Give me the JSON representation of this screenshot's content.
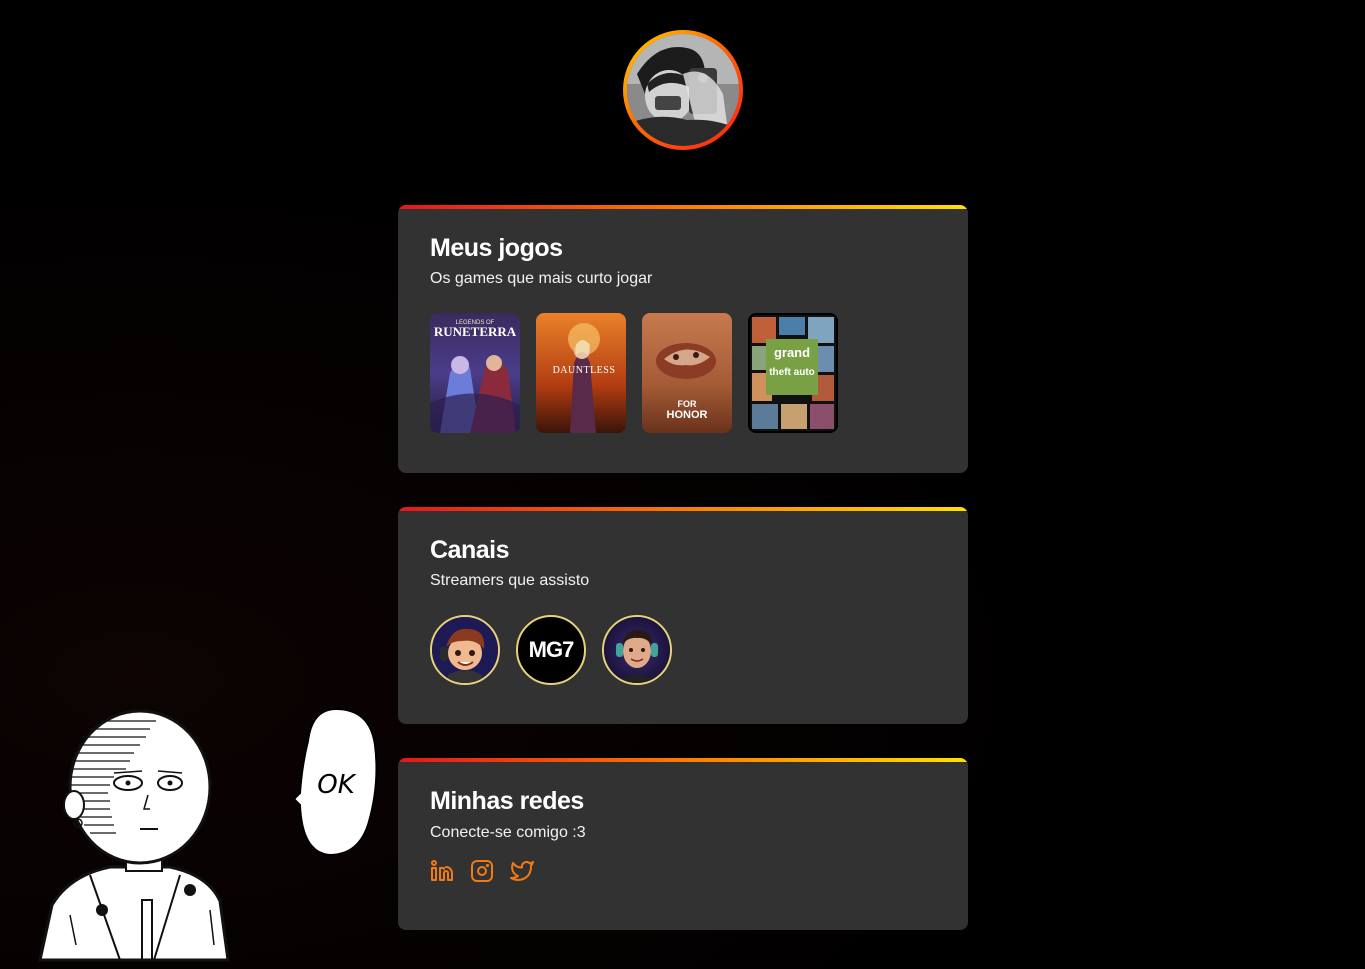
{
  "profile": {
    "avatar_icon": "profile-photo"
  },
  "games_card": {
    "title": "Meus jogos",
    "subtitle": "Os games que mais curto jogar",
    "games": [
      {
        "name": "Legends of Runeterra",
        "cover_text_1": "LEGENDS OF",
        "cover_text_2": "RUNETERRA"
      },
      {
        "name": "Dauntless",
        "cover_text_1": "DAUNTLESS",
        "cover_text_2": ""
      },
      {
        "name": "For Honor",
        "cover_text_1": "FOR",
        "cover_text_2": "HONOR"
      },
      {
        "name": "Grand Theft Auto V",
        "cover_text_1": "grand",
        "cover_text_2": "theft auto"
      }
    ]
  },
  "channels_card": {
    "title": "Canais",
    "subtitle": "Streamers que assisto",
    "streamers": [
      {
        "icon": "streamer-avatar-cartoon"
      },
      {
        "label": "MG7"
      },
      {
        "icon": "streamer-avatar-photo"
      }
    ]
  },
  "social_card": {
    "title": "Minhas redes",
    "subtitle": "Conecte-se comigo :3",
    "links": [
      {
        "icon": "linkedin-icon"
      },
      {
        "icon": "instagram-icon"
      },
      {
        "icon": "twitter-icon"
      }
    ]
  },
  "mascot": {
    "speech": "OK"
  },
  "colors": {
    "background": "#000000",
    "card": "#323232",
    "gradient_start": "#e5161c",
    "gradient_mid": "#ff7a00",
    "gradient_end": "#ffe100",
    "accent_icon": "#f07a13"
  }
}
